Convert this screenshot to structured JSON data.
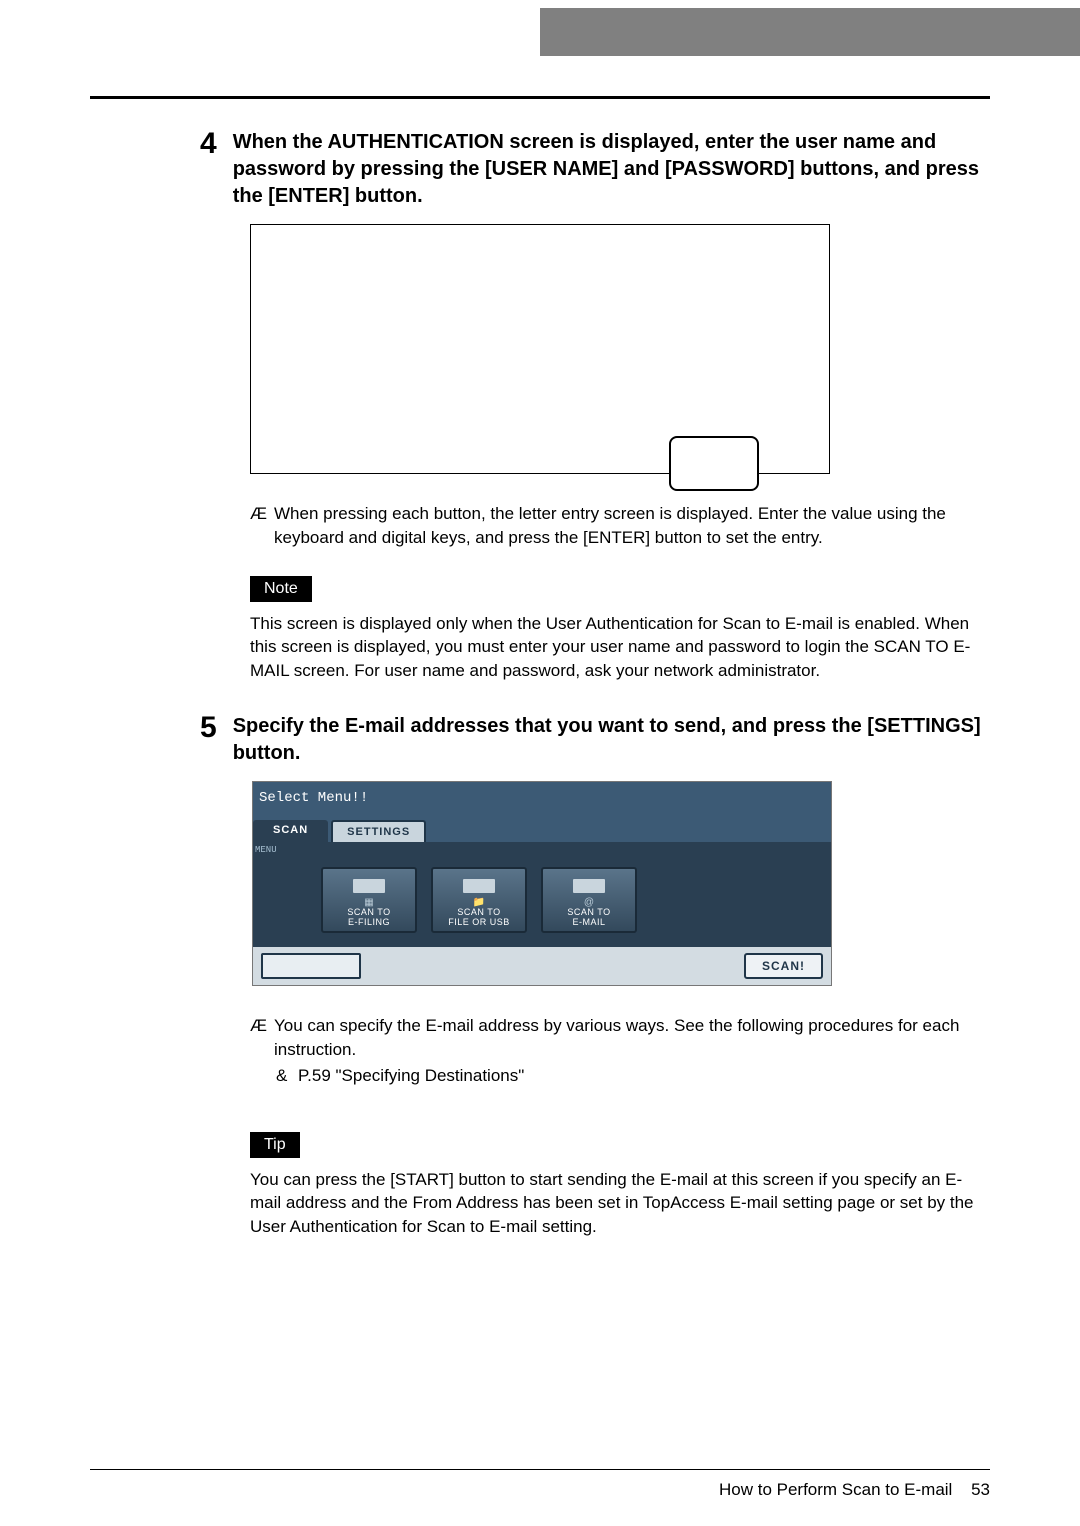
{
  "step4": {
    "number": "4",
    "heading": "When the AUTHENTICATION screen is displayed, enter the user name and password by pressing the [USER NAME] and [PASSWORD] buttons, and press the [ENTER] button.",
    "bullet_symbol": "Æ",
    "bullet_text": "When pressing each button, the letter entry screen is displayed.  Enter the value using the keyboard and digital keys, and press the [ENTER] button to set the entry.",
    "note_label": "Note",
    "note_body": "This screen is displayed only when the User Authentication for Scan to E-mail is enabled.  When this screen is displayed, you must enter your user name and password to login the SCAN TO E-MAIL screen.  For user name and password, ask your network administrator."
  },
  "step5": {
    "number": "5",
    "heading": "Specify the E-mail addresses that you want to send, and press the [SETTINGS] button.",
    "scan_menu": {
      "prompt": "Select Menu!!",
      "tab_scan": "SCAN",
      "tab_settings": "SETTINGS",
      "menu_label": "MENU",
      "buttons": [
        "SCAN TO\nE-FILING",
        "SCAN TO\nFILE OR USB",
        "SCAN TO\nE-MAIL"
      ],
      "scan_button": "SCAN!"
    },
    "bullet_symbol": "Æ",
    "bullet_text": "You can specify the E-mail address by various ways.  See the following procedures for each instruction.",
    "sub_bullet_symbol": "&",
    "sub_bullet_text": "P.59 \"Specifying Destinations\"",
    "tip_label": "Tip",
    "tip_body": "You can press the [START] button to start sending the E-mail at this screen if you specify an E-mail address and the From Address has been set in TopAccess E-mail setting page or set by the User Authentication for Scan to E-mail setting."
  },
  "footer": {
    "title": "How to Perform Scan to E-mail",
    "page": "53"
  }
}
